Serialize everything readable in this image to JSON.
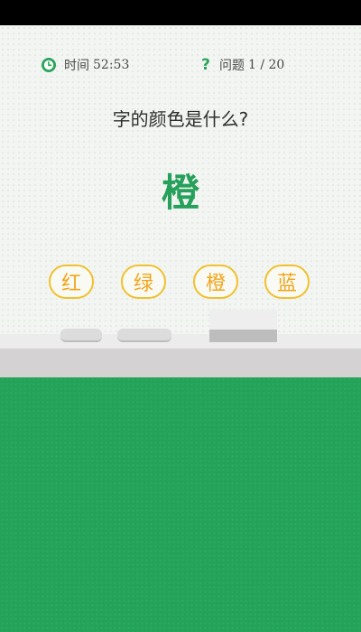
{
  "hud": {
    "timer_label": "时间",
    "timer_value": "52:53",
    "question_label": "问题",
    "question_value": "1 / 20"
  },
  "prompt": "字的颜色是什么?",
  "word": {
    "text": "橙",
    "color": "#26a05a"
  },
  "options": [
    "红",
    "绿",
    "橙",
    "蓝"
  ],
  "colors": {
    "accent": "#2aa55a",
    "option_border": "#f0c12e",
    "option_text": "#f0a51a",
    "floor": "#24a25a"
  },
  "icons": {
    "timer": "clock-icon",
    "question": "question-mark-icon"
  }
}
